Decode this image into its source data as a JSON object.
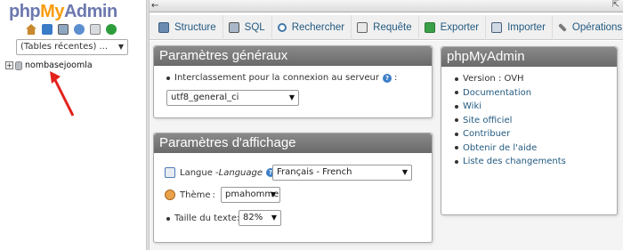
{
  "nav": {
    "logo": {
      "php": "php",
      "my": "My",
      "admin": "Admin"
    },
    "icons": [
      "home-icon",
      "exit-icon",
      "sql-query-icon",
      "documentation-icon",
      "copy-icon",
      "reload-icon"
    ],
    "recent_tables": "(Tables récentes) ...",
    "databases": [
      {
        "expander": "+",
        "name": "nombasejoomla"
      }
    ],
    "annotation_arrow_color": "#e3221b"
  },
  "topbar": {
    "back_symbol": "←",
    "maximize_symbol": "⇱"
  },
  "tabs": [
    {
      "label": "Structure",
      "icon": "structure-icon"
    },
    {
      "label": "SQL",
      "icon": "sql-icon"
    },
    {
      "label": "Rechercher",
      "icon": "search-icon"
    },
    {
      "label": "Requête",
      "icon": "query-icon"
    },
    {
      "label": "Exporter",
      "icon": "export-icon"
    },
    {
      "label": "Importer",
      "icon": "import-icon"
    },
    {
      "label": "Opérations",
      "icon": "operations-icon"
    }
  ],
  "general_settings": {
    "title": "Paramètres généraux",
    "collation_label": "Interclassement pour la connexion au serveur",
    "collation_suffix": ":",
    "collation_value": "utf8_general_ci"
  },
  "display_settings": {
    "title": "Paramètres d'affichage",
    "language_label_prefix": "Langue - ",
    "language_label_italic": "Language",
    "language_suffix": ":",
    "language_value": "Français - French",
    "theme_label": "Thème",
    "theme_suffix": ":",
    "theme_value": "pmahomme",
    "font_size_label": "Taille du texte:",
    "font_size_value": "82%"
  },
  "pma_panel": {
    "title": "phpMyAdmin",
    "items": [
      {
        "label": "Version : OVH",
        "link": false
      },
      {
        "label": "Documentation",
        "link": true
      },
      {
        "label": "Wiki",
        "link": true
      },
      {
        "label": "Site officiel",
        "link": true
      },
      {
        "label": "Contribuer",
        "link": true
      },
      {
        "label": "Obtenir de l'aide",
        "link": true
      },
      {
        "label": "Liste des changements",
        "link": true
      }
    ]
  },
  "colors": {
    "link": "#235a81",
    "panel_header": "#7a7a7a",
    "logo_blue": "#6c78af",
    "logo_orange": "#f89c0e",
    "help_icon": "#3d7fc8"
  }
}
